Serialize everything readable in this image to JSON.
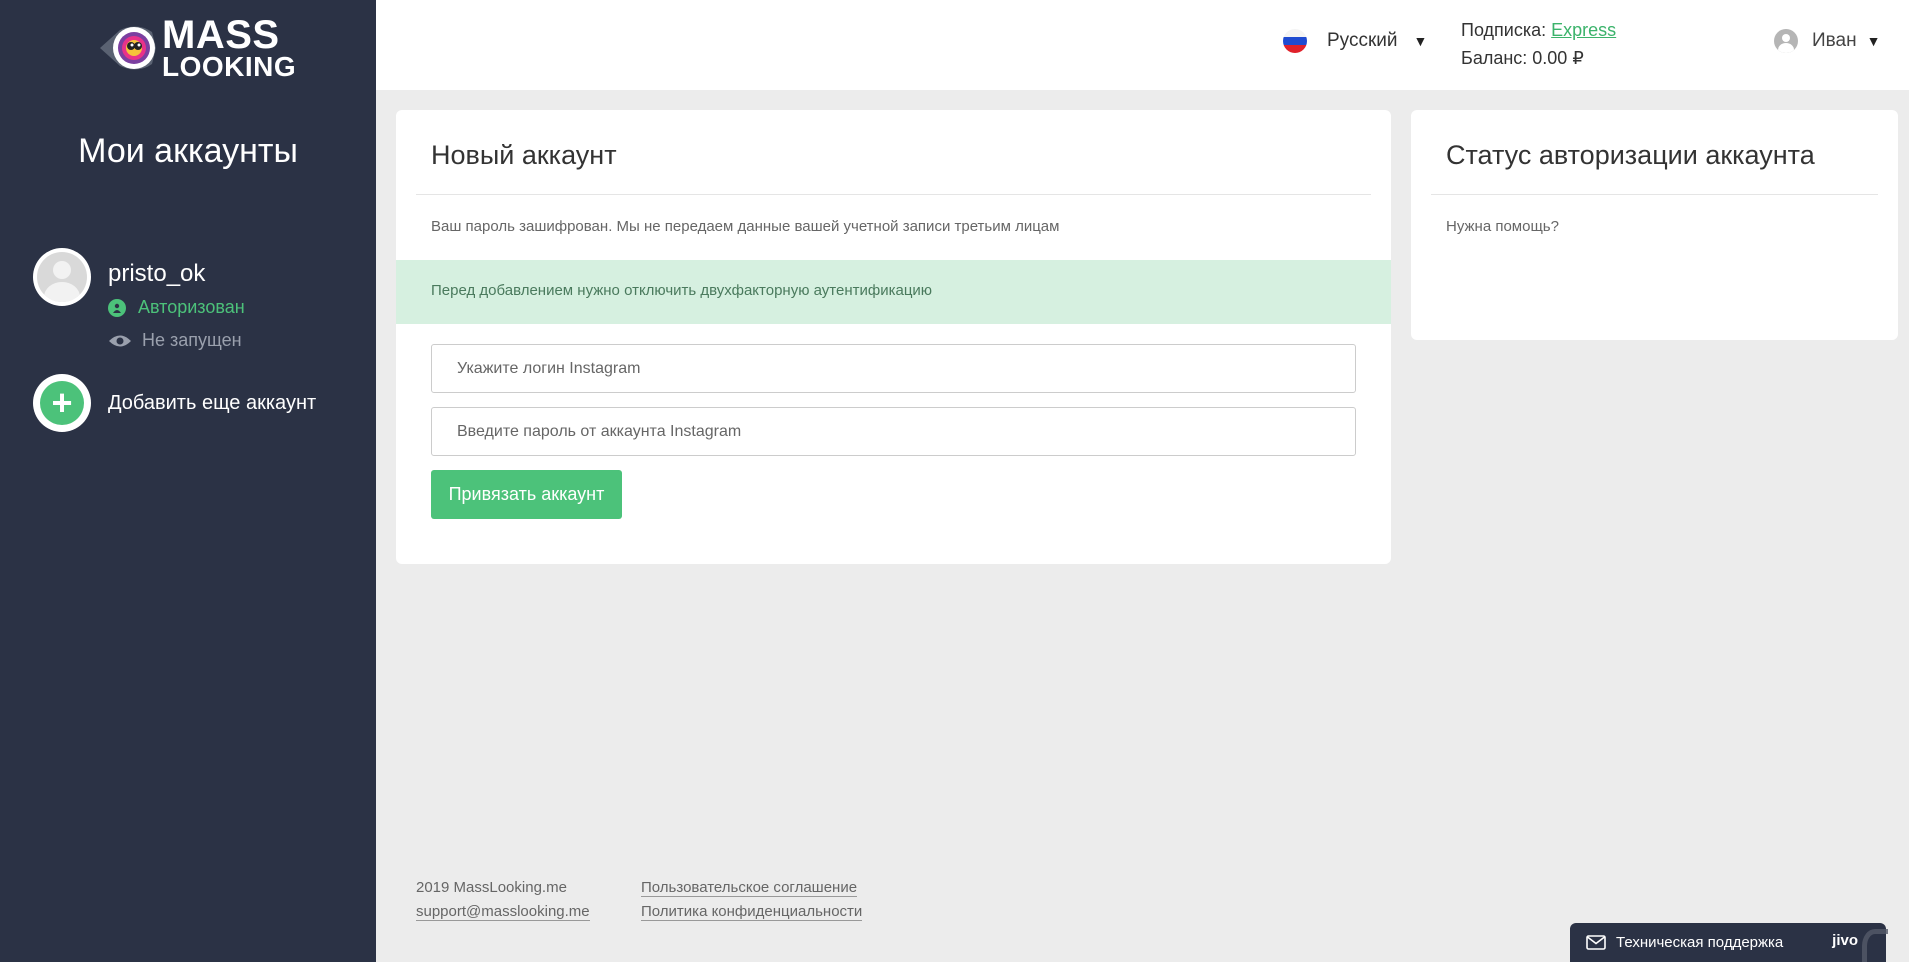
{
  "logo": {
    "line1": "MASS",
    "line2": "LOOKING"
  },
  "sidebar": {
    "title": "Мои аккаунты",
    "account": {
      "name": "pristo_ok",
      "status": "Авторизован",
      "run_state": "Не запущен"
    },
    "add_label": "Добавить еще аккаунт"
  },
  "header": {
    "language": "Русский",
    "subscription_label": "Подписка:",
    "subscription_plan": "Express",
    "balance": "Баланс: 0.00 ₽",
    "user_name": "Иван"
  },
  "new_account": {
    "title": "Новый аккаунт",
    "note": "Ваш пароль зашифрован. Мы не передаем данные вашей учетной записи третьим лицам",
    "alert": "Перед добавлением нужно отключить двухфакторную аутентификацию",
    "login_placeholder": "Укажите логин Instagram",
    "password_placeholder": "Введите пароль от аккаунта Instagram",
    "submit": "Привязать аккаунт"
  },
  "status_card": {
    "title": "Статус авторизации аккаунта",
    "help": "Нужна помощь?"
  },
  "footer": {
    "copyright": "2019 MassLooking.me",
    "email": "support@masslooking.me",
    "terms": "Пользовательское соглашение",
    "privacy": "Политика конфиденциальности"
  },
  "support": {
    "label": "Техническая поддержка",
    "brand": "jivo"
  },
  "colors": {
    "sidebar_bg": "#2b3245",
    "accent_green": "#4cc27a",
    "alert_bg": "#d6f0e0",
    "page_bg": "#ececec"
  }
}
